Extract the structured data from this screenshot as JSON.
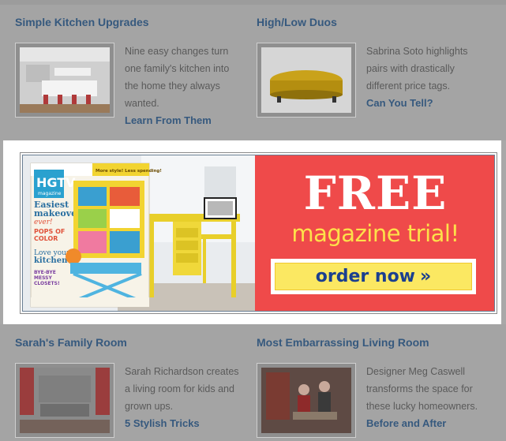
{
  "top_cards": [
    {
      "title": "Simple Kitchen Upgrades",
      "text": "Nine easy changes turn one family's kitchen into the home they always wanted.",
      "link": "Learn From Them",
      "image": "kitchen-photo"
    },
    {
      "title": "High/Low Duos",
      "text": "Sabrina Soto highlights pairs with drastically different price tags.",
      "link": "Can You Tell?",
      "image": "yellow-ottoman-photo"
    }
  ],
  "bottom_cards": [
    {
      "title": "Sarah's Family Room",
      "text": "Sarah Richardson creates a living room for kids and grown ups.",
      "link": "5 Stylish Tricks",
      "image": "family-room-photo"
    },
    {
      "title": "Most Embarrassing Living Room",
      "text": "Designer Meg Caswell transforms the space for these lucky homeowners.",
      "link": "Before and After",
      "image": "living-room-couple-photo"
    }
  ],
  "ad": {
    "headline": "FREE",
    "subheadline": "magazine trial!",
    "cta": "order now",
    "cta_icon": "double-chevron-right",
    "magazine": {
      "brand": "HGTV",
      "brand_sub": "magazine",
      "banner": "More style! Less spending!",
      "cover_lines": [
        "Easiest makeovers ever!",
        "POPS OF COLOR",
        "Love your kitchen",
        "BYE-BYE MESSY CLOSETS!"
      ]
    },
    "colors": {
      "red": "#ef4a4a",
      "yellow": "#fde14a",
      "button_text": "#1b3f8f"
    }
  },
  "colors": {
    "link": "#36597e",
    "body_text": "#5a5a5a",
    "overlay": "#a4a4a4"
  }
}
